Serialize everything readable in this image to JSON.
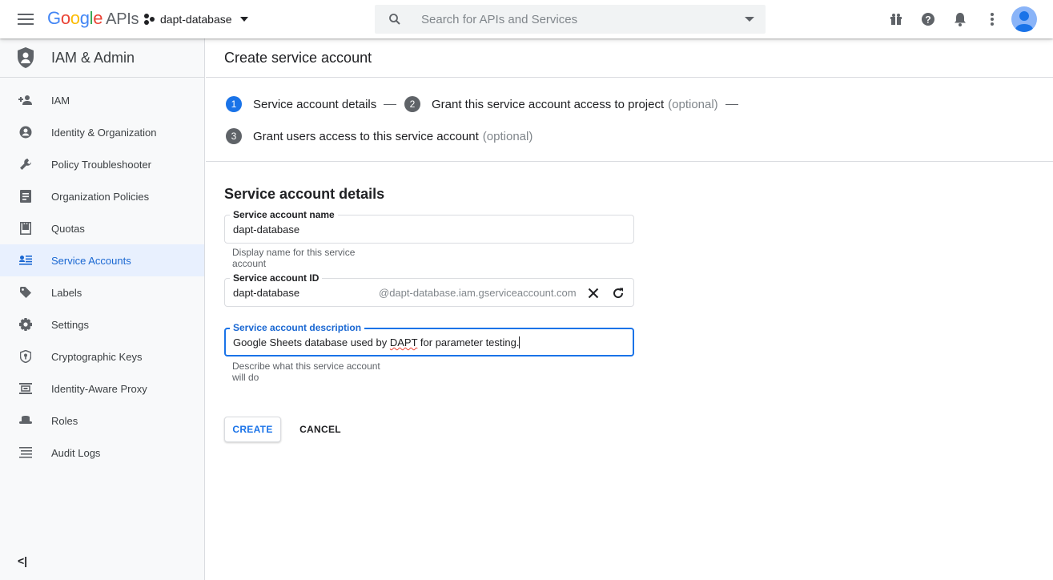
{
  "header": {
    "logo": {
      "g": "G",
      "o1": "o",
      "o2": "o",
      "g2": "g",
      "l": "l",
      "e": "e",
      "apis": "APIs"
    },
    "project_name": "dapt-database",
    "search_placeholder": "Search for APIs and Services"
  },
  "sidebar": {
    "title": "IAM & Admin",
    "items": [
      {
        "label": "IAM",
        "icon": "person-add-icon"
      },
      {
        "label": "Identity & Organization",
        "icon": "account-circle-icon"
      },
      {
        "label": "Policy Troubleshooter",
        "icon": "wrench-icon"
      },
      {
        "label": "Organization Policies",
        "icon": "policy-doc-icon"
      },
      {
        "label": "Quotas",
        "icon": "quota-icon"
      },
      {
        "label": "Service Accounts",
        "icon": "service-account-icon"
      },
      {
        "label": "Labels",
        "icon": "label-tag-icon"
      },
      {
        "label": "Settings",
        "icon": "gear-icon"
      },
      {
        "label": "Cryptographic Keys",
        "icon": "key-shield-icon"
      },
      {
        "label": "Identity-Aware Proxy",
        "icon": "proxy-icon"
      },
      {
        "label": "Roles",
        "icon": "roles-hat-icon"
      },
      {
        "label": "Audit Logs",
        "icon": "list-lines-icon"
      }
    ],
    "active": "Service Accounts",
    "collapse_label": "<|"
  },
  "page": {
    "title": "Create service account",
    "steps": [
      {
        "num": "1",
        "label": "Service account details",
        "optional": ""
      },
      {
        "num": "2",
        "label": "Grant this service account access to project",
        "optional": "(optional)"
      },
      {
        "num": "3",
        "label": "Grant users access to this service account",
        "optional": "(optional)"
      }
    ],
    "section_title": "Service account details",
    "name_field": {
      "label": "Service account name",
      "value": "dapt-database",
      "hint": "Display name for this service account"
    },
    "id_field": {
      "label": "Service account ID",
      "value": "dapt-database",
      "suffix": "@dapt-database.iam.gserviceaccount.com"
    },
    "desc_field": {
      "label": "Service account description",
      "value_before": "Google Sheets database used by ",
      "value_squiggle": "DAPT",
      "value_after": " for parameter testing.",
      "hint": "Describe what this service account will do"
    },
    "create_label": "CREATE",
    "cancel_label": "CANCEL"
  },
  "colors": {
    "accent": "#1a73e8",
    "active_bg": "#e8f0fe",
    "sidebar_bg": "#f8f9fa"
  }
}
